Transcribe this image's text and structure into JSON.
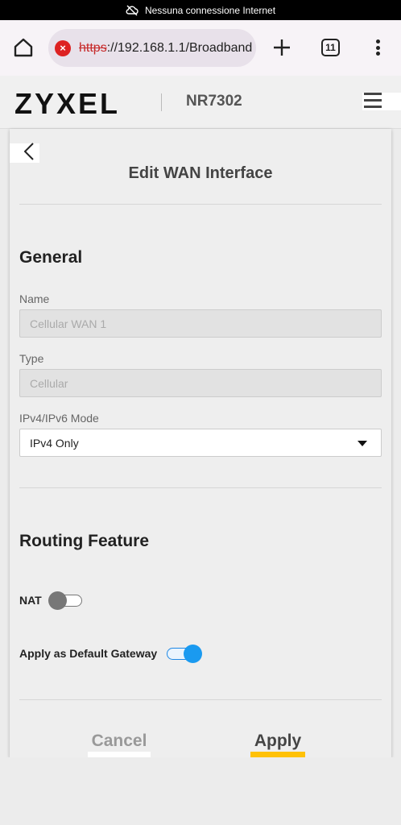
{
  "status_bar": {
    "text": "Nessuna connessione Internet",
    "icon": "cloud-off-icon"
  },
  "browser": {
    "url_scheme": "https",
    "url_rest": "://192.168.1.1/Broadband",
    "security_icon": "not-secure-icon",
    "tab_count": "11"
  },
  "header": {
    "logo": "ZYXEL",
    "model": "NR7302"
  },
  "page": {
    "title": "Edit WAN Interface"
  },
  "general": {
    "title": "General",
    "name_label": "Name",
    "name_value": "Cellular WAN 1",
    "type_label": "Type",
    "type_value": "Cellular",
    "mode_label": "IPv4/IPv6 Mode",
    "mode_value": "IPv4 Only"
  },
  "routing": {
    "title": "Routing Feature",
    "nat_label": "NAT",
    "nat_enabled": false,
    "gateway_label": "Apply as Default Gateway",
    "gateway_enabled": true
  },
  "actions": {
    "cancel": "Cancel",
    "apply": "Apply"
  },
  "colors": {
    "accent": "#1a9af0",
    "apply_highlight": "#ffc107",
    "insecure": "#c62828"
  }
}
